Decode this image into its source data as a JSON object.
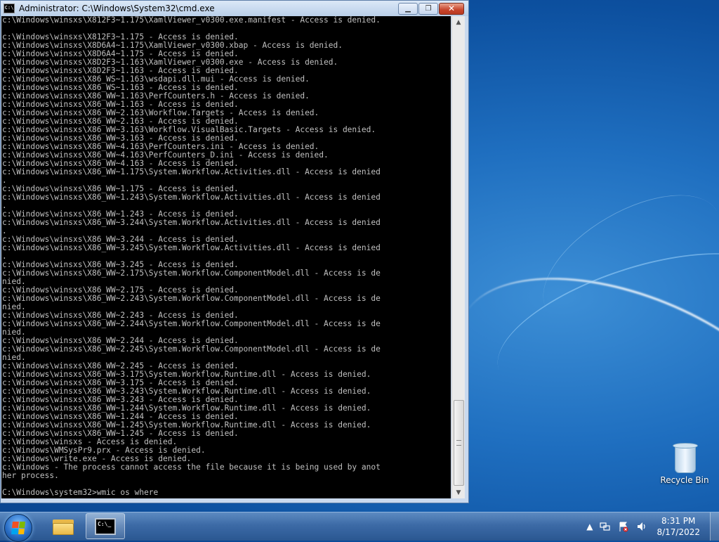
{
  "window": {
    "title": "Administrator: C:\\Windows\\System32\\cmd.exe",
    "minimize": "▁",
    "maximize": "❐",
    "close": "✕",
    "console_lines": [
      "c:\\Windows\\winsxs\\X812F3~1.175\\XamlViewer_v0300.exe.manifest - Access is denied.",
      "",
      "c:\\Windows\\winsxs\\X812F3~1.175 - Access is denied.",
      "c:\\Windows\\winsxs\\X8D6A4~1.175\\XamlViewer_v0300.xbap - Access is denied.",
      "c:\\Windows\\winsxs\\X8D6A4~1.175 - Access is denied.",
      "c:\\Windows\\winsxs\\X8D2F3~1.163\\XamlViewer_v0300.exe - Access is denied.",
      "c:\\Windows\\winsxs\\X8D2F3~1.163 - Access is denied.",
      "c:\\Windows\\winsxs\\X86_WS~1.163\\wsdapi.dll.mui - Access is denied.",
      "c:\\Windows\\winsxs\\X86_WS~1.163 - Access is denied.",
      "c:\\Windows\\winsxs\\X86_WW~1.163\\PerfCounters.h - Access is denied.",
      "c:\\Windows\\winsxs\\X86_WW~1.163 - Access is denied.",
      "c:\\Windows\\winsxs\\X86_WW~2.163\\Workflow.Targets - Access is denied.",
      "c:\\Windows\\winsxs\\X86_WW~2.163 - Access is denied.",
      "c:\\Windows\\winsxs\\X86_WW~3.163\\Workflow.VisualBasic.Targets - Access is denied.",
      "c:\\Windows\\winsxs\\X86_WW~3.163 - Access is denied.",
      "c:\\Windows\\winsxs\\X86_WW~4.163\\PerfCounters.ini - Access is denied.",
      "c:\\Windows\\winsxs\\X86_WW~4.163\\PerfCounters_D.ini - Access is denied.",
      "c:\\Windows\\winsxs\\X86_WW~4.163 - Access is denied.",
      "c:\\Windows\\winsxs\\X86_WW~1.175\\System.Workflow.Activities.dll - Access is denied",
      ".",
      "c:\\Windows\\winsxs\\X86_WW~1.175 - Access is denied.",
      "c:\\Windows\\winsxs\\X86_WW~1.243\\System.Workflow.Activities.dll - Access is denied",
      ".",
      "c:\\Windows\\winsxs\\X86_WW~1.243 - Access is denied.",
      "c:\\Windows\\winsxs\\X86_WW~3.244\\System.Workflow.Activities.dll - Access is denied",
      ".",
      "c:\\Windows\\winsxs\\X86_WW~3.244 - Access is denied.",
      "c:\\Windows\\winsxs\\X86_WW~3.245\\System.Workflow.Activities.dll - Access is denied",
      ".",
      "c:\\Windows\\winsxs\\X86_WW~3.245 - Access is denied.",
      "c:\\Windows\\winsxs\\X86_WW~2.175\\System.Workflow.ComponentModel.dll - Access is de",
      "nied.",
      "c:\\Windows\\winsxs\\X86_WW~2.175 - Access is denied.",
      "c:\\Windows\\winsxs\\X86_WW~2.243\\System.Workflow.ComponentModel.dll - Access is de",
      "nied.",
      "c:\\Windows\\winsxs\\X86_WW~2.243 - Access is denied.",
      "c:\\Windows\\winsxs\\X86_WW~2.244\\System.Workflow.ComponentModel.dll - Access is de",
      "nied.",
      "c:\\Windows\\winsxs\\X86_WW~2.244 - Access is denied.",
      "c:\\Windows\\winsxs\\X86_WW~2.245\\System.Workflow.ComponentModel.dll - Access is de",
      "nied.",
      "c:\\Windows\\winsxs\\X86_WW~2.245 - Access is denied.",
      "c:\\Windows\\winsxs\\X86_WW~3.175\\System.Workflow.Runtime.dll - Access is denied.",
      "c:\\Windows\\winsxs\\X86_WW~3.175 - Access is denied.",
      "c:\\Windows\\winsxs\\X86_WW~3.243\\System.Workflow.Runtime.dll - Access is denied.",
      "c:\\Windows\\winsxs\\X86_WW~3.243 - Access is denied.",
      "c:\\Windows\\winsxs\\X86_WW~1.244\\System.Workflow.Runtime.dll - Access is denied.",
      "c:\\Windows\\winsxs\\X86_WW~1.244 - Access is denied.",
      "c:\\Windows\\winsxs\\X86_WW~1.245\\System.Workflow.Runtime.dll - Access is denied.",
      "c:\\Windows\\winsxs\\X86_WW~1.245 - Access is denied.",
      "c:\\Windows\\winsxs - Access is denied.",
      "c:\\Windows\\WMSysPr9.prx - Access is denied.",
      "c:\\Windows\\write.exe - Access is denied.",
      "c:\\Windows - The process cannot access the file because it is being used by anot",
      "her process.",
      "",
      "C:\\Windows\\system32>wmic os where"
    ],
    "scroll_up": "▲",
    "scroll_down": "▼"
  },
  "desktop": {
    "recycle_bin_label": "Recycle Bin"
  },
  "taskbar": {
    "cmd_icon_text": "C:\\_",
    "tray_chevron": "▲",
    "clock_time": "8:31 PM",
    "clock_date": "8/17/2022"
  },
  "colors": {
    "console_bg": "#000000",
    "console_fg": "#c0c0c0",
    "close_button": "#c7452c"
  }
}
